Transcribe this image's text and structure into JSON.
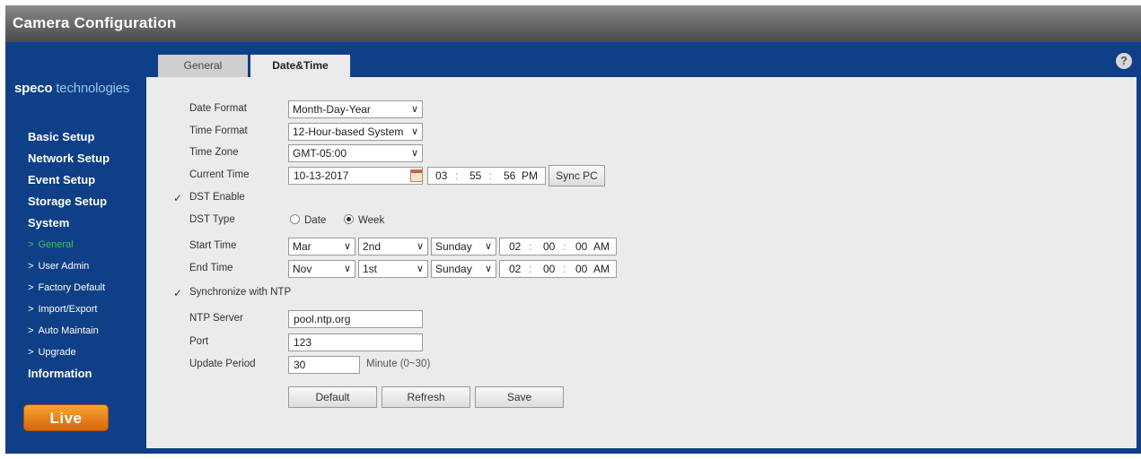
{
  "window": {
    "title": "Camera Configuration"
  },
  "logo": {
    "brand": "speco",
    "suffix": "technologies"
  },
  "nav": {
    "items": [
      {
        "label": "Basic Setup"
      },
      {
        "label": "Network Setup"
      },
      {
        "label": "Event Setup"
      },
      {
        "label": "Storage Setup"
      },
      {
        "label": "System"
      }
    ],
    "sub_items": [
      {
        "label": "General",
        "active": true
      },
      {
        "label": "User Admin"
      },
      {
        "label": "Factory Default"
      },
      {
        "label": "Import/Export"
      },
      {
        "label": "Auto Maintain"
      },
      {
        "label": "Upgrade"
      }
    ],
    "information": "Information",
    "chevron": ">",
    "live_label": "Live"
  },
  "help_icon": "?",
  "tabs": {
    "general": "General",
    "datetime": "Date&Time"
  },
  "form": {
    "date_format": {
      "label": "Date Format",
      "value": "Month-Day-Year"
    },
    "time_format": {
      "label": "Time Format",
      "value": "12-Hour-based System"
    },
    "time_zone": {
      "label": "Time Zone",
      "value": "GMT-05:00"
    },
    "current_time": {
      "label": "Current Time",
      "date": "10-13-2017",
      "hour": "03",
      "minute": "55",
      "second": "56",
      "ampm": "PM",
      "sync_label": "Sync PC"
    },
    "dst_enable": {
      "label": "DST Enable",
      "checked": true
    },
    "dst_type": {
      "label": "DST Type",
      "option_date": "Date",
      "option_week": "Week",
      "selected": "Week"
    },
    "start_time": {
      "label": "Start Time",
      "month": "Mar",
      "week": "2nd",
      "day": "Sunday",
      "hour": "02",
      "minute": "00",
      "second": "00",
      "ampm": "AM"
    },
    "end_time": {
      "label": "End Time",
      "month": "Nov",
      "week": "1st",
      "day": "Sunday",
      "hour": "02",
      "minute": "00",
      "second": "00",
      "ampm": "AM"
    },
    "ntp_sync": {
      "label": "Synchronize with NTP",
      "checked": true
    },
    "ntp_server": {
      "label": "NTP Server",
      "value": "pool.ntp.org"
    },
    "port": {
      "label": "Port",
      "value": "123"
    },
    "update_period": {
      "label": "Update Period",
      "value": "30",
      "unit": "Minute (0~30)"
    }
  },
  "buttons": {
    "default": "Default",
    "refresh": "Refresh",
    "save": "Save"
  },
  "glyphs": {
    "dropdown": "∨",
    "check": "✓",
    "colon": ":"
  }
}
